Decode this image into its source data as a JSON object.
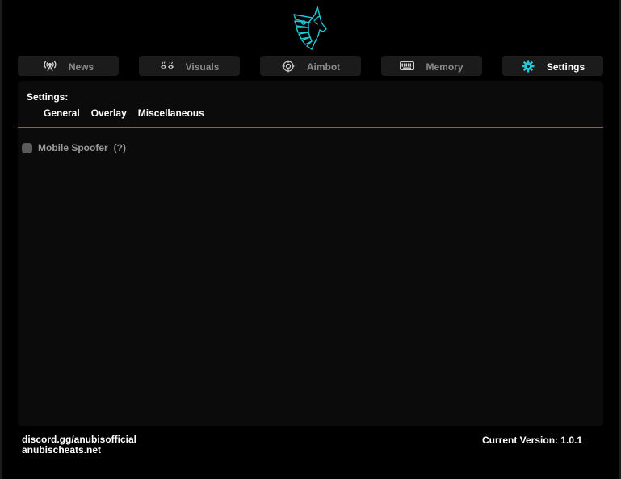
{
  "colors": {
    "accent": "#1fc9d6",
    "background": "#000000",
    "panel": "#0b0b0b",
    "tab_bg": "#1b1b1b",
    "inactive_text": "#8b8b8b",
    "divider": "#1d8a96"
  },
  "logo": {
    "icon": "anubis-logo-icon"
  },
  "tabs": [
    {
      "label": "News",
      "icon": "antenna-icon",
      "active": false
    },
    {
      "label": "Visuals",
      "icon": "eyes-icon",
      "active": false
    },
    {
      "label": "Aimbot",
      "icon": "crosshair-icon",
      "active": false
    },
    {
      "label": "Memory",
      "icon": "keyboard-icon",
      "active": false
    },
    {
      "label": "Settings",
      "icon": "gear-icon",
      "active": true
    }
  ],
  "settings": {
    "title": "Settings:",
    "subtabs": [
      "General",
      "Overlay",
      "Miscellaneous"
    ],
    "options": [
      {
        "label": "Mobile Spoofer",
        "help": "(?)",
        "checked": false
      }
    ]
  },
  "footer": {
    "discord": "discord.gg/anubisofficial",
    "website": "anubischeats.net",
    "version": "Current Version: 1.0.1"
  }
}
